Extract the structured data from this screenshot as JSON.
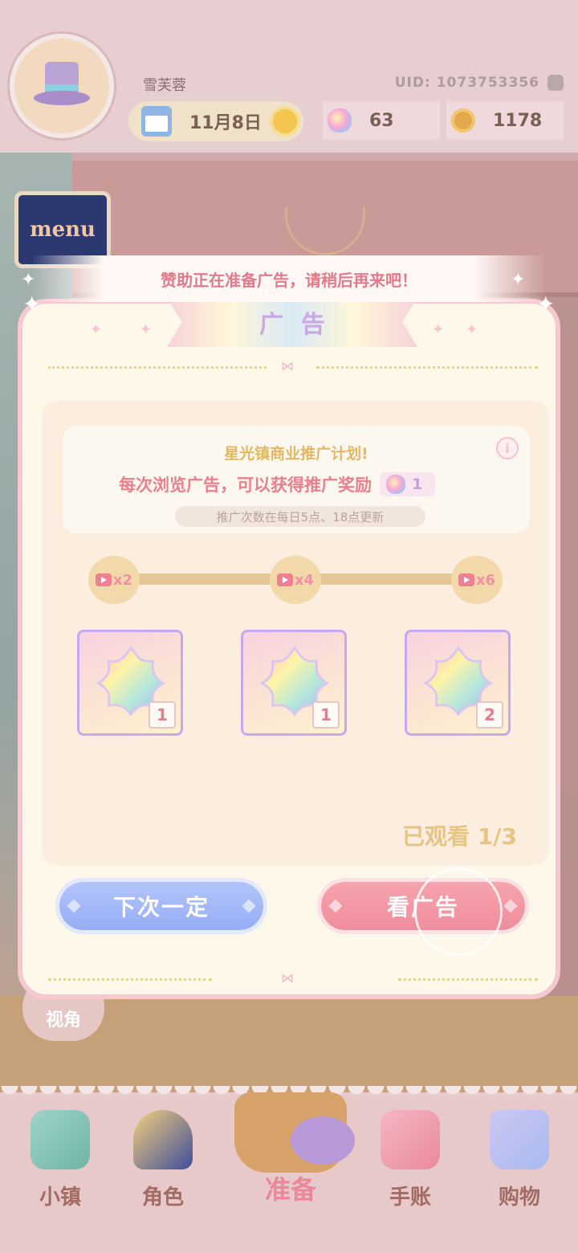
{
  "header": {
    "username": "雪芙蓉",
    "uid": "UID: 1073753356",
    "date": "11月8日",
    "gems": "63",
    "coins": "1178"
  },
  "menu_label": "menu",
  "toast": "赞助正在准备广告，请稍后再来吧！",
  "dialog": {
    "title": "广告",
    "info_title": "星光镇商业推广计划!",
    "info_icon": "i",
    "reward_text": "每次浏览广告，可以获得推广奖励",
    "reward_amount": "1",
    "refresh_note": "推广次数在每日5点、18点更新",
    "milestones": [
      "x2",
      "x4",
      "x6"
    ],
    "rewards": [
      "1",
      "1",
      "2"
    ],
    "watched": "已观看 1/3",
    "btn_next": "下次一定",
    "btn_watch": "看广告"
  },
  "view_label": "视角",
  "nav": {
    "town": "小镇",
    "character": "角色",
    "prepare": "准备",
    "journal": "手账",
    "shop": "购物"
  },
  "colors": {
    "accent_pink": "#ea7f8d",
    "accent_blue": "#97aef6",
    "gold": "#e5c486"
  }
}
